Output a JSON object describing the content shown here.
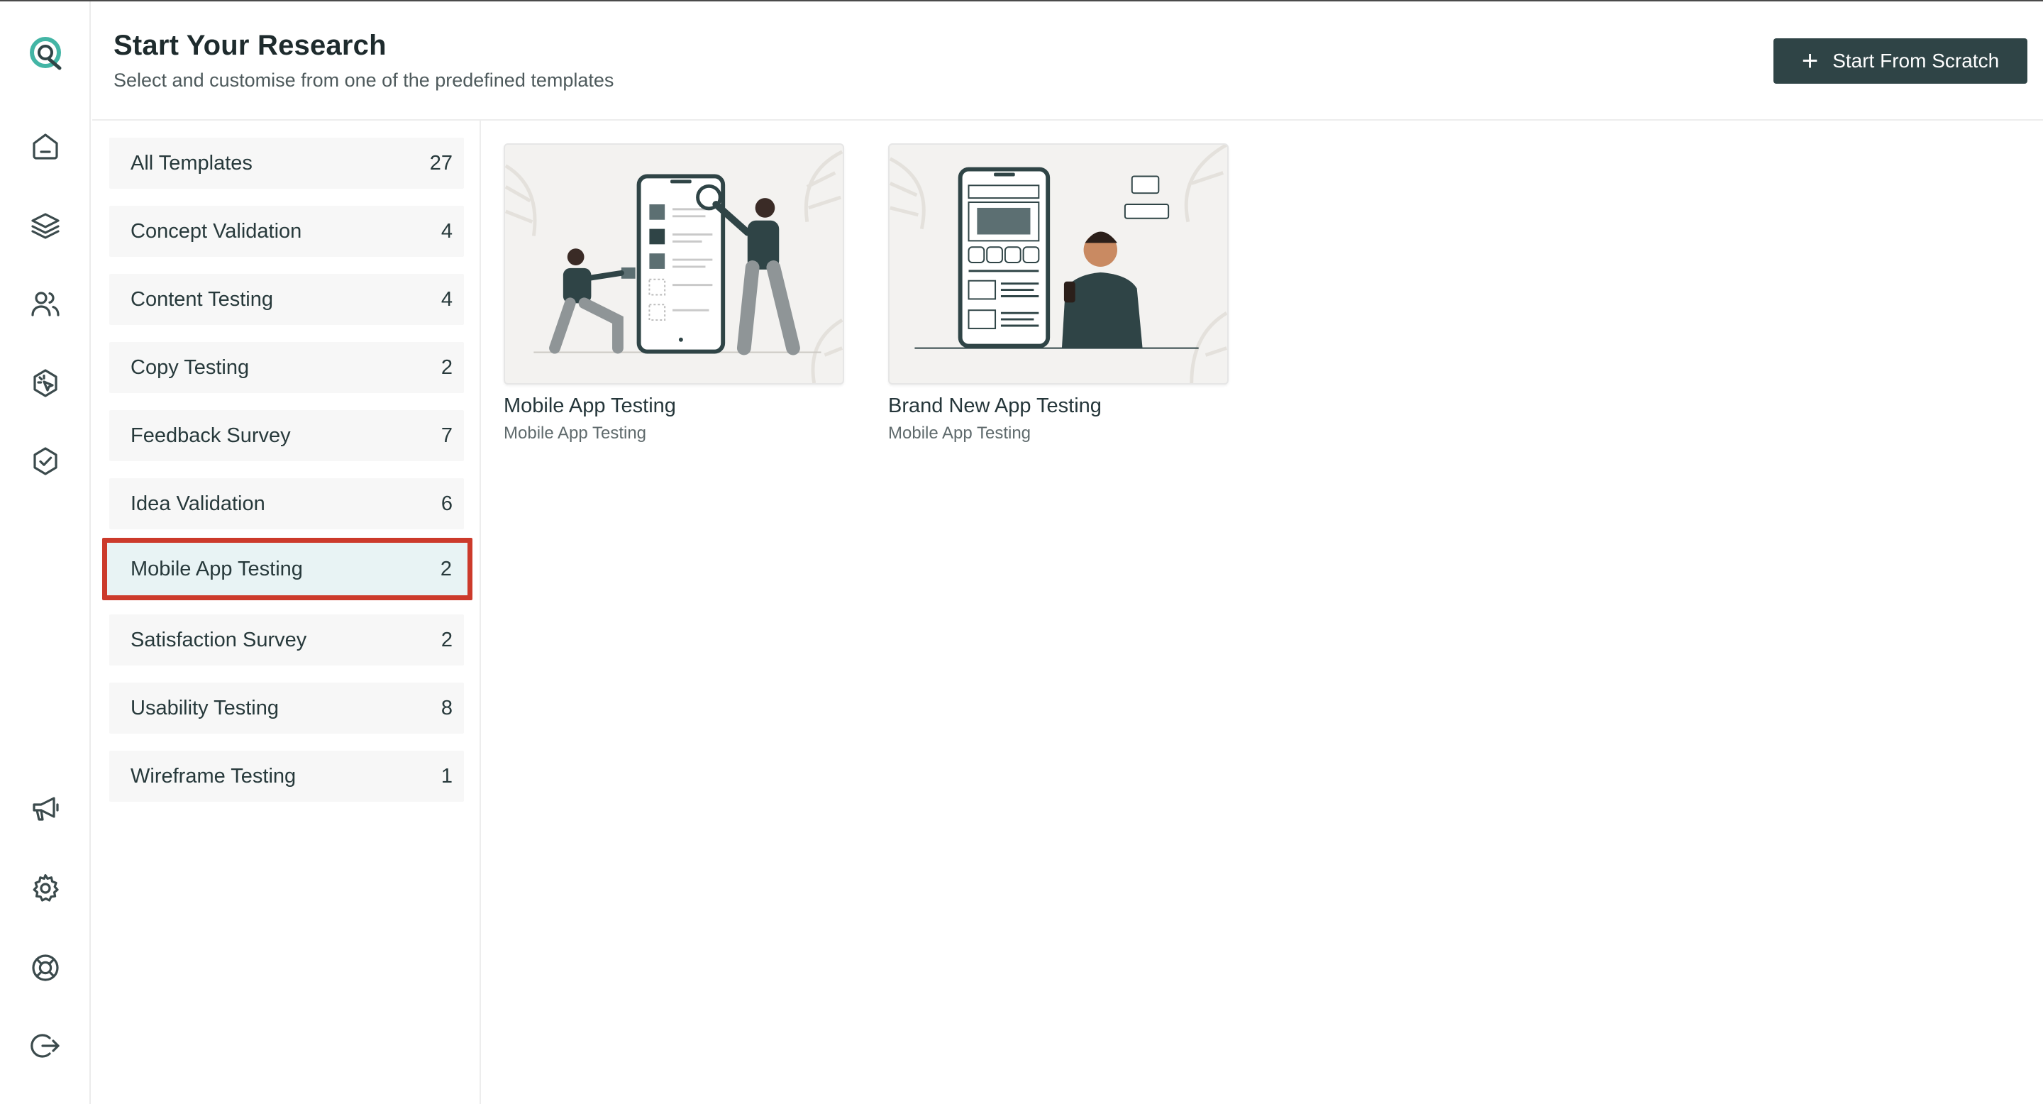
{
  "header": {
    "title": "Start Your Research",
    "subtitle": "Select and customise from one of the predefined templates",
    "start_button_label": "Start From Scratch",
    "start_button_icon": "plus-icon"
  },
  "rail": {
    "logo": "brand-logo",
    "top_icons": [
      "home-icon",
      "layers-icon",
      "users-icon",
      "click-badge-icon",
      "check-badge-icon"
    ],
    "bottom_icons": [
      "megaphone-icon",
      "gear-icon",
      "lifebuoy-icon",
      "logout-icon"
    ]
  },
  "categories": [
    {
      "label": "All Templates",
      "count": "27"
    },
    {
      "label": "Concept Validation",
      "count": "4"
    },
    {
      "label": "Content Testing",
      "count": "4"
    },
    {
      "label": "Copy Testing",
      "count": "2"
    },
    {
      "label": "Feedback Survey",
      "count": "7"
    },
    {
      "label": "Idea Validation",
      "count": "6"
    },
    {
      "label": "Mobile App Testing",
      "count": "2",
      "selected": true
    },
    {
      "label": "Satisfaction Survey",
      "count": "2"
    },
    {
      "label": "Usability Testing",
      "count": "8"
    },
    {
      "label": "Wireframe Testing",
      "count": "1"
    }
  ],
  "templates": [
    {
      "title": "Mobile App Testing",
      "category": "Mobile App Testing",
      "illustration": "mobile-app-illustration"
    },
    {
      "title": "Brand New App Testing",
      "category": "Mobile App Testing",
      "illustration": "phone-user-illustration"
    }
  ],
  "colors": {
    "accent": "#2f4446",
    "brand_teal": "#3fb3a3",
    "selected_bg": "#e8f3f4",
    "selection_outline": "#cc3a2b"
  }
}
